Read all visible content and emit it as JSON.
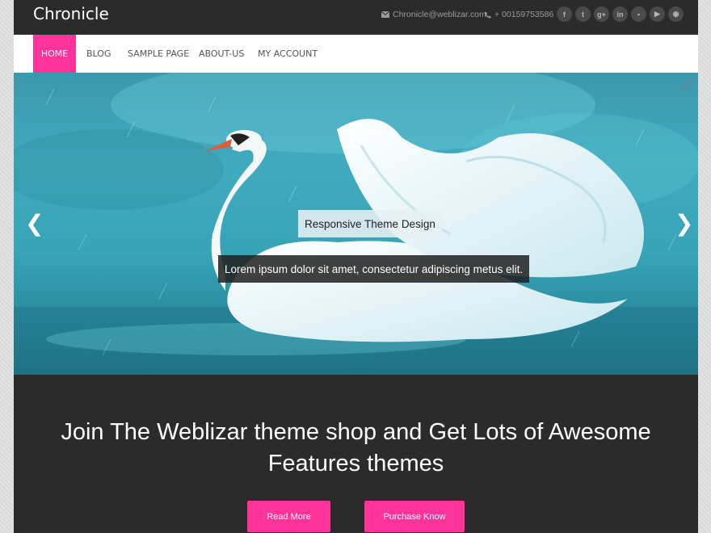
{
  "header": {
    "brand": "Chronicle",
    "email": "Chronicle@weblizar.com",
    "phone": "+ 00159753586",
    "socials": [
      {
        "name": "facebook",
        "glyph": "f"
      },
      {
        "name": "twitter",
        "glyph": "t"
      },
      {
        "name": "google-plus",
        "glyph": "g+"
      },
      {
        "name": "linkedin",
        "glyph": "in"
      },
      {
        "name": "flickr",
        "glyph": "▪"
      },
      {
        "name": "youtube",
        "glyph": "▶"
      },
      {
        "name": "rss",
        "glyph": "◉"
      }
    ]
  },
  "nav": {
    "items": [
      {
        "label": "HOME",
        "active": true
      },
      {
        "label": "BLOG",
        "active": false
      },
      {
        "label": "SAMPLE PAGE",
        "active": false
      },
      {
        "label": "ABOUT-US",
        "active": false
      },
      {
        "label": "MY ACCOUNT",
        "active": false
      }
    ]
  },
  "slider": {
    "caption_title": "Responsive Theme Design",
    "caption_text": "Lorem ipsum dolor sit amet, consectetur adipiscing metus elit.",
    "prev_glyph": "❮",
    "next_glyph": "❯"
  },
  "promo": {
    "title": "Join The Weblizar theme shop and Get Lots of Awesome Features themes",
    "read_more": "Read More",
    "purchase": "Purchase Know"
  },
  "colors": {
    "accent": "#ff3399",
    "dark": "#2b2b2b"
  }
}
